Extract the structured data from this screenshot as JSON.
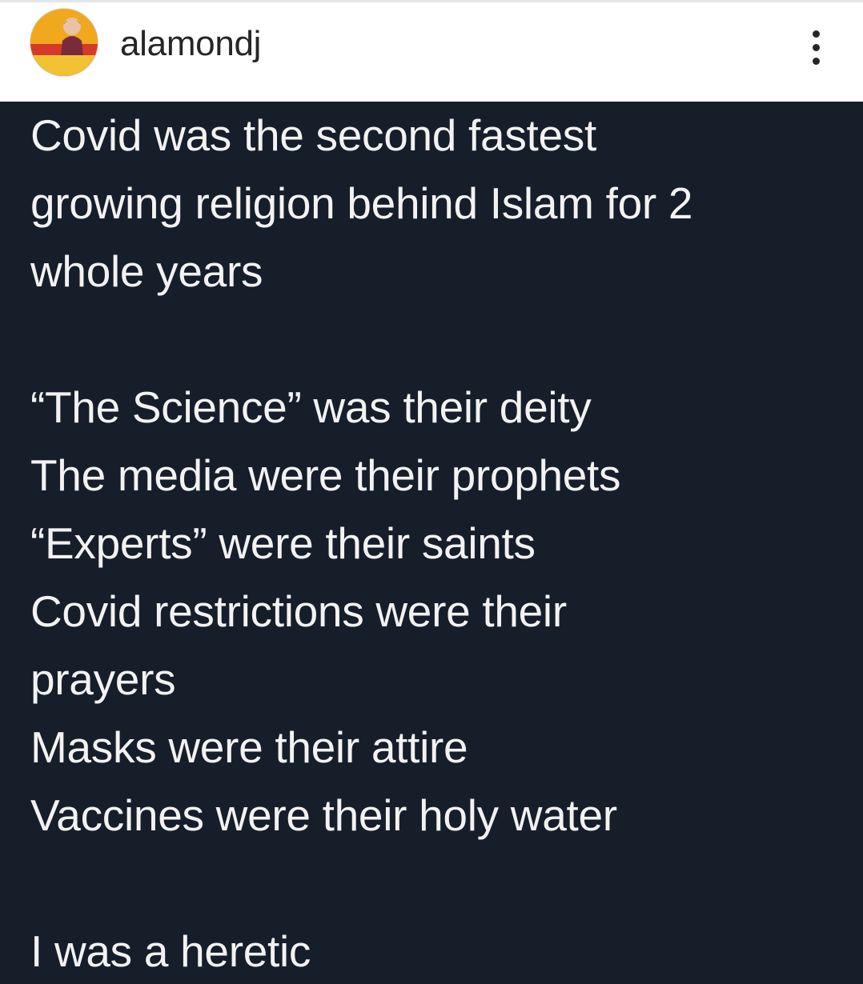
{
  "post": {
    "username": "alamondj",
    "avatar_icon": "profile-avatar-icon",
    "more_icon": "more-options-icon"
  },
  "tweet": {
    "lines": [
      "Covid was the second fastest",
      "growing religion behind Islam for 2",
      "whole years",
      "",
      "“The Science” was their deity",
      "The media were their prophets",
      "“Experts” were their saints",
      "Covid restrictions were their",
      "prayers",
      "Masks were their attire",
      "Vaccines were their holy water",
      "",
      "I was a heretic"
    ]
  },
  "colors": {
    "header_bg": "#ffffff",
    "username_color": "#262626",
    "tweet_bg": "#151e29",
    "tweet_text": "#f2f2f2"
  }
}
